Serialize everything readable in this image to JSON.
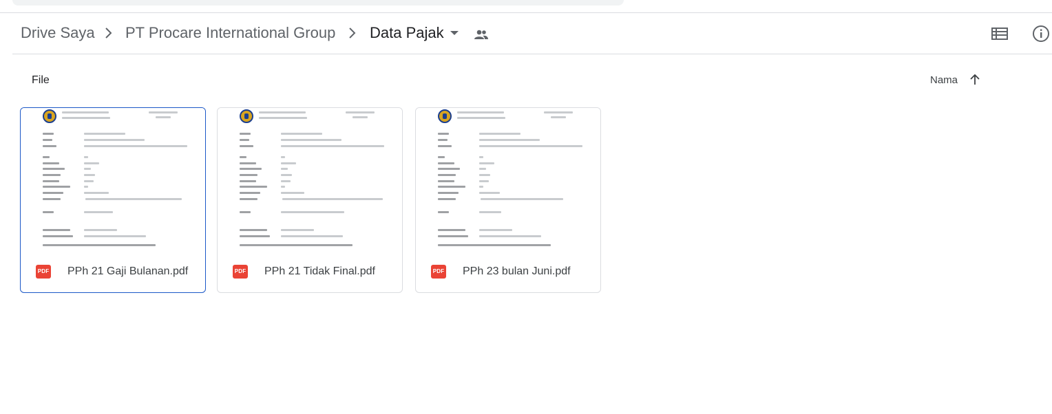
{
  "breadcrumb": {
    "items": [
      "Drive Saya",
      "PT Procare International Group",
      "Data Pajak"
    ]
  },
  "icons": {
    "separator": "chevron-right-icon",
    "dropdown": "caret-down-icon",
    "shared": "people-icon",
    "list_view": "list-view-icon",
    "info": "info-icon",
    "sort": "arrow-up-icon",
    "file_type": "pdf-icon"
  },
  "section": {
    "label": "File"
  },
  "sort": {
    "label": "Nama"
  },
  "files": [
    {
      "name": "PPh 21 Gaji Bulanan.pdf",
      "type_label": "PDF",
      "selected": true
    },
    {
      "name": "PPh 21 Tidak Final.pdf",
      "type_label": "PDF",
      "selected": false
    },
    {
      "name": "PPh 23 bulan Juni.pdf",
      "type_label": "PDF",
      "selected": false
    }
  ],
  "colors": {
    "selected_border": "#1a57c7",
    "pdf_red": "#ea4335"
  }
}
